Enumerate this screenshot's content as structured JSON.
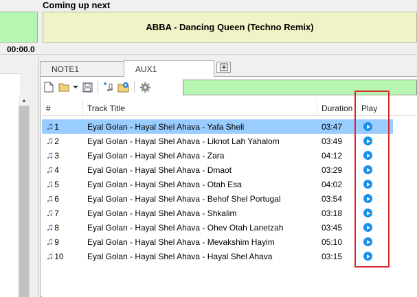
{
  "header": {
    "time": "00:00.0",
    "coming_up_label": "Coming up next",
    "coming_up_track": "ABBA - Dancing Queen (Techno Remix)"
  },
  "tabs": [
    {
      "label": "NOTE1",
      "active": false
    },
    {
      "label": "AUX1",
      "active": true
    }
  ],
  "toolbar": {
    "buttons": [
      "new-file-icon",
      "open-folder-icon",
      "dropdown-icon",
      "save-icon",
      "add-track-icon",
      "add-folder-icon",
      "settings-icon"
    ]
  },
  "table": {
    "columns": {
      "num": "#",
      "title": "Track Title",
      "duration": "Duration",
      "play": "Play"
    },
    "rows": [
      {
        "num": "1",
        "title": "Eyal Golan - Hayal Shel Ahava - Yafa Sheli",
        "duration": "03:47"
      },
      {
        "num": "2",
        "title": "Eyal Golan - Hayal Shel Ahava - Liknot Lah Yahalom",
        "duration": "03:49"
      },
      {
        "num": "3",
        "title": "Eyal Golan - Hayal Shel Ahava - Zara",
        "duration": "04:12"
      },
      {
        "num": "4",
        "title": "Eyal Golan - Hayal Shel Ahava - Dmaot",
        "duration": "03:29"
      },
      {
        "num": "5",
        "title": "Eyal Golan - Hayal Shel Ahava - Otah Esa",
        "duration": "04:02"
      },
      {
        "num": "6",
        "title": "Eyal Golan - Hayal Shel Ahava - Behof Shel Portugal",
        "duration": "03:54"
      },
      {
        "num": "7",
        "title": "Eyal Golan - Hayal Shel Ahava - Shkalim",
        "duration": "03:18"
      },
      {
        "num": "8",
        "title": "Eyal Golan - Hayal Shel Ahava - Ohev Otah Lanetzah",
        "duration": "03:45"
      },
      {
        "num": "9",
        "title": "Eyal Golan - Hayal Shel Ahava - Mevakshim Hayim",
        "duration": "05:10"
      },
      {
        "num": "10",
        "title": "Eyal Golan - Hayal Shel Ahava - Hayal Shel Ahava",
        "duration": "03:15"
      }
    ],
    "selected_row": 0
  },
  "colors": {
    "selected_row": "#99ccff",
    "play_button": "#1a8fe6",
    "highlight_box": "#d62a2a",
    "green_field": "#b7f5b3",
    "coming_up_bg": "#f0f3c6"
  }
}
